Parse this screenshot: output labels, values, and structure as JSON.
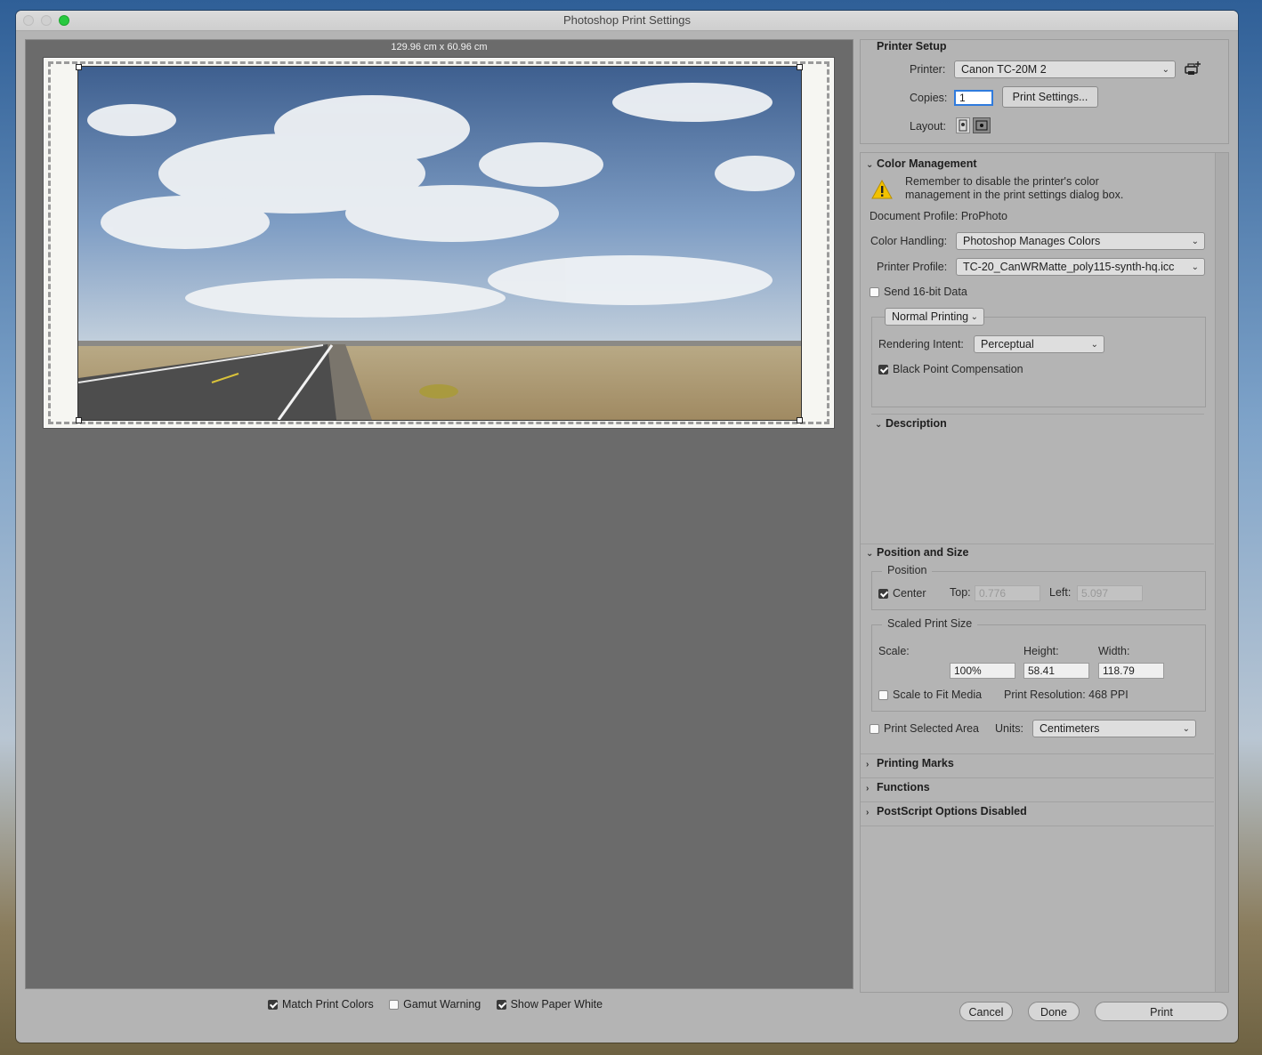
{
  "window": {
    "title": "Photoshop Print Settings"
  },
  "preview": {
    "dimensions": "129.96 cm x 60.96 cm"
  },
  "bottom_options": {
    "match_print_colors": {
      "label": "Match Print Colors",
      "checked": true
    },
    "gamut_warning": {
      "label": "Gamut Warning",
      "checked": false
    },
    "show_paper_white": {
      "label": "Show Paper White",
      "checked": true
    }
  },
  "printer_setup": {
    "title": "Printer Setup",
    "printer_label": "Printer:",
    "printer_value": "Canon TC-20M 2",
    "copies_label": "Copies:",
    "copies_value": "1",
    "print_settings_button": "Print Settings...",
    "layout_label": "Layout:"
  },
  "color_management": {
    "title": "Color Management",
    "warning_line1": "Remember to disable the printer's color",
    "warning_line2": "management in the print settings dialog box.",
    "document_profile": "Document Profile: ProPhoto",
    "color_handling_label": "Color Handling:",
    "color_handling_value": "Photoshop Manages Colors",
    "printer_profile_label": "Printer Profile:",
    "printer_profile_value": "TC-20_CanWRMatte_poly115-synth-hq.icc",
    "send_16bit_label": "Send 16-bit Data",
    "send_16bit_checked": false,
    "normal_printing": "Normal Printing",
    "rendering_intent_label": "Rendering Intent:",
    "rendering_intent_value": "Perceptual",
    "black_point_label": "Black Point Compensation",
    "black_point_checked": true
  },
  "description": {
    "title": "Description"
  },
  "position_and_size": {
    "title": "Position and Size",
    "position_legend": "Position",
    "center_label": "Center",
    "center_checked": true,
    "top_label": "Top:",
    "top_value": "0.776",
    "left_label": "Left:",
    "left_value": "5.097",
    "scaled_legend": "Scaled Print Size",
    "scale_label": "Scale:",
    "height_label": "Height:",
    "width_label": "Width:",
    "scale_value": "100%",
    "height_value": "58.41",
    "width_value": "118.79",
    "scale_to_fit_label": "Scale to Fit Media",
    "scale_to_fit_checked": false,
    "print_resolution": "Print Resolution: 468 PPI",
    "print_selected_label": "Print Selected Area",
    "print_selected_checked": false,
    "units_label": "Units:",
    "units_value": "Centimeters"
  },
  "collapsed_sections": {
    "printing_marks": "Printing Marks",
    "functions": "Functions",
    "postscript": "PostScript Options Disabled"
  },
  "buttons": {
    "cancel": "Cancel",
    "done": "Done",
    "print": "Print"
  },
  "icons": {
    "add_printer": "add-printer-icon",
    "layout_portrait": "portrait-layout-icon",
    "layout_landscape": "landscape-layout-icon",
    "warning": "warning-icon"
  },
  "colors": {
    "accent": "#2f7bdd",
    "warning": "#f2c200"
  }
}
